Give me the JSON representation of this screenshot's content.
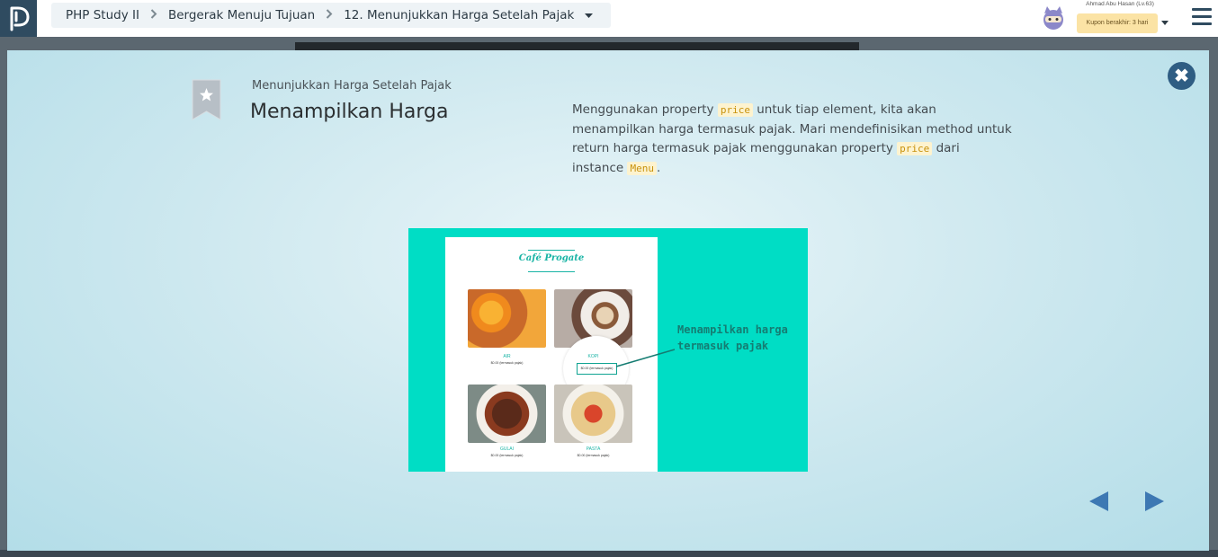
{
  "breadcrumb": {
    "course": "PHP Study II",
    "chapter": "Bergerak Menuju Tujuan",
    "lesson": "12. Menunjukkan Harga Setelah Pajak"
  },
  "user": {
    "name": "Ahmad Abu Hasan (Lv.63)",
    "coupon": "Kupon berakhir: 3 hari"
  },
  "slide": {
    "subtitle": "Menunjukkan Harga Setelah Pajak",
    "title": "Menampilkan Harga",
    "desc": {
      "p1": "Menggunakan property ",
      "code1": "price",
      "p2": " untuk tiap element, kita akan menampilkan harga termasuk pajak. Mari mendefinisikan method untuk return harga termasuk pajak menggunakan property ",
      "code2": "price",
      "p3": " dari instance ",
      "code3": "Menu",
      "p4": "."
    },
    "close_symbol": "✖"
  },
  "illustration": {
    "cafe_name": "Café Progate",
    "items": [
      {
        "name": "AIR",
        "price": "$0.00 (termasuk pajak)"
      },
      {
        "name": "KOPI",
        "price": "$0.00 (termasuk pajak)"
      },
      {
        "name": "GULAI",
        "price": "$0.00 (termasuk pajak)"
      },
      {
        "name": "PASTA",
        "price": "$0.00 (termasuk pajak)"
      }
    ],
    "callout_line1": "Menampilkan harga",
    "callout_line2": "termasuk pajak"
  },
  "colors": {
    "accent": "#00ddc5",
    "nav": "#3d78b3",
    "close_bg": "#2f5d83"
  }
}
